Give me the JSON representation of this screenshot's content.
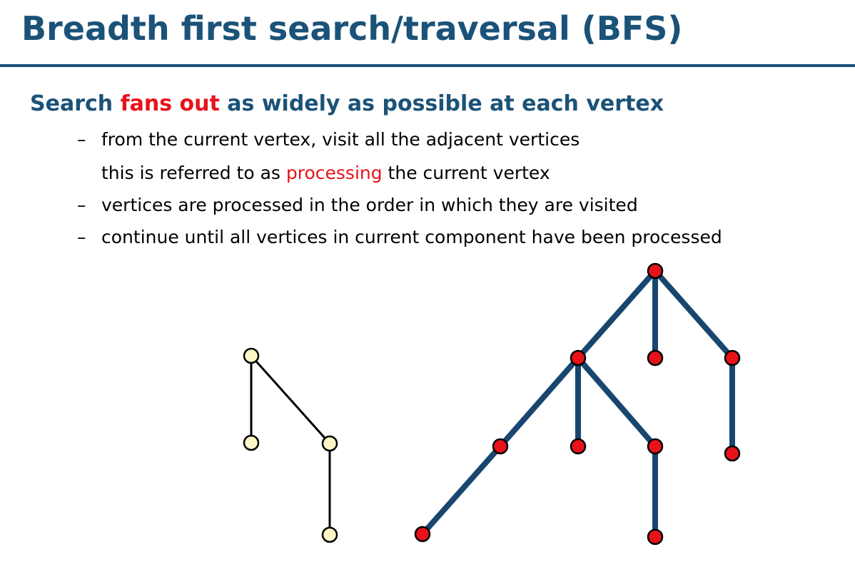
{
  "slide": {
    "title": "Breadth first search/traversal (BFS)",
    "heading": {
      "before": "Search ",
      "highlight": "fans out",
      "after": " as widely as possible at each vertex"
    },
    "dash": "–",
    "bullets": {
      "b1_line1": "from the current vertex, visit all the adjacent vertices",
      "b1_line2_before": "this is referred to as ",
      "b1_line2_highlight": "processing",
      "b1_line2_after": " the current vertex",
      "b2": "vertices are processed in the order in which they are visited",
      "b3": "continue until all vertices in current component have been processed"
    }
  },
  "colors": {
    "title": "#1b5278",
    "highlight": "#e8121b",
    "visited_node_fill": "#e8121b",
    "unvisited_node_fill": "#fdf7c6",
    "tree_edge": "#18466f",
    "plain_edge": "#000000"
  },
  "diagram": {
    "components": [
      {
        "name": "unvisited-component",
        "vertices": [
          "u1",
          "u2",
          "u3",
          "u4"
        ],
        "edges": [
          [
            "u1",
            "u2"
          ],
          [
            "u1",
            "u3"
          ],
          [
            "u3",
            "u4"
          ]
        ],
        "state": "unvisited"
      },
      {
        "name": "bfs-tree-component",
        "vertices": [
          "r",
          "a",
          "b",
          "c",
          "a1",
          "a2",
          "a3",
          "a4",
          "a5",
          "c1"
        ],
        "edges": [
          [
            "r",
            "a"
          ],
          [
            "r",
            "b"
          ],
          [
            "r",
            "c"
          ],
          [
            "a",
            "a1"
          ],
          [
            "a1",
            "a4"
          ],
          [
            "a",
            "a2"
          ],
          [
            "a",
            "a3"
          ],
          [
            "a3",
            "a5"
          ],
          [
            "c",
            "c1"
          ]
        ],
        "state": "processed"
      }
    ]
  }
}
